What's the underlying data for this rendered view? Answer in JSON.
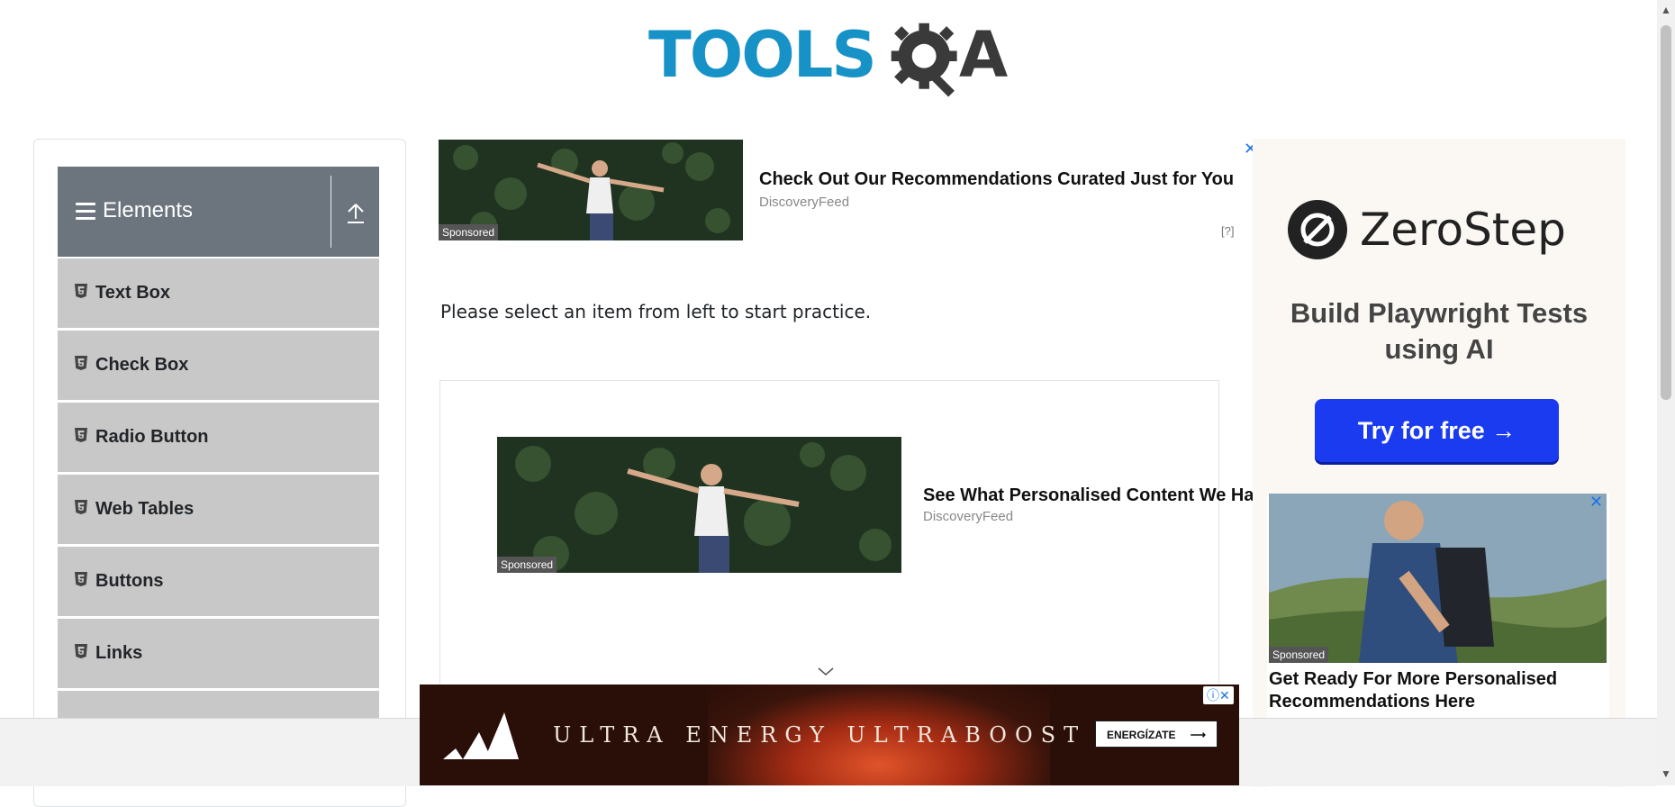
{
  "header": {
    "logo_text_main": "TOOLS",
    "logo_text_end": "A"
  },
  "sidebar": {
    "group_title": "Elements",
    "items": [
      {
        "label": "Text Box"
      },
      {
        "label": "Check Box"
      },
      {
        "label": "Radio Button"
      },
      {
        "label": "Web Tables"
      },
      {
        "label": "Buttons"
      },
      {
        "label": "Links"
      }
    ]
  },
  "main": {
    "instruction": "Please select an item from left to start practice."
  },
  "ads": {
    "top": {
      "title": "Check Out Our Recommendations Curated Just for You",
      "source": "DiscoveryFeed",
      "sponsored": "Sponsored",
      "close": "✕",
      "help": "[?]"
    },
    "middle": {
      "title": "See What Personalised Content We Ha",
      "source": "DiscoveryFeed",
      "sponsored": "Sponsored"
    },
    "right": {
      "brand": "ZeroStep",
      "tagline": "Build Playwright Tests using AI",
      "button": "Try for free →"
    },
    "right_native": {
      "title": "Get Ready For More Personalised Recommendations Here",
      "sponsored": "Sponsored",
      "close": "✕"
    },
    "bottom": {
      "slogan": "ULTRA ENERGY  ULTRABOOST",
      "cta": "ENERGÍZATE",
      "adchoice": "ⓘ✕"
    }
  },
  "colors": {
    "accent": "#1792c7",
    "sidebar_header": "#6c757d",
    "menu_item": "#c8c8c8"
  }
}
